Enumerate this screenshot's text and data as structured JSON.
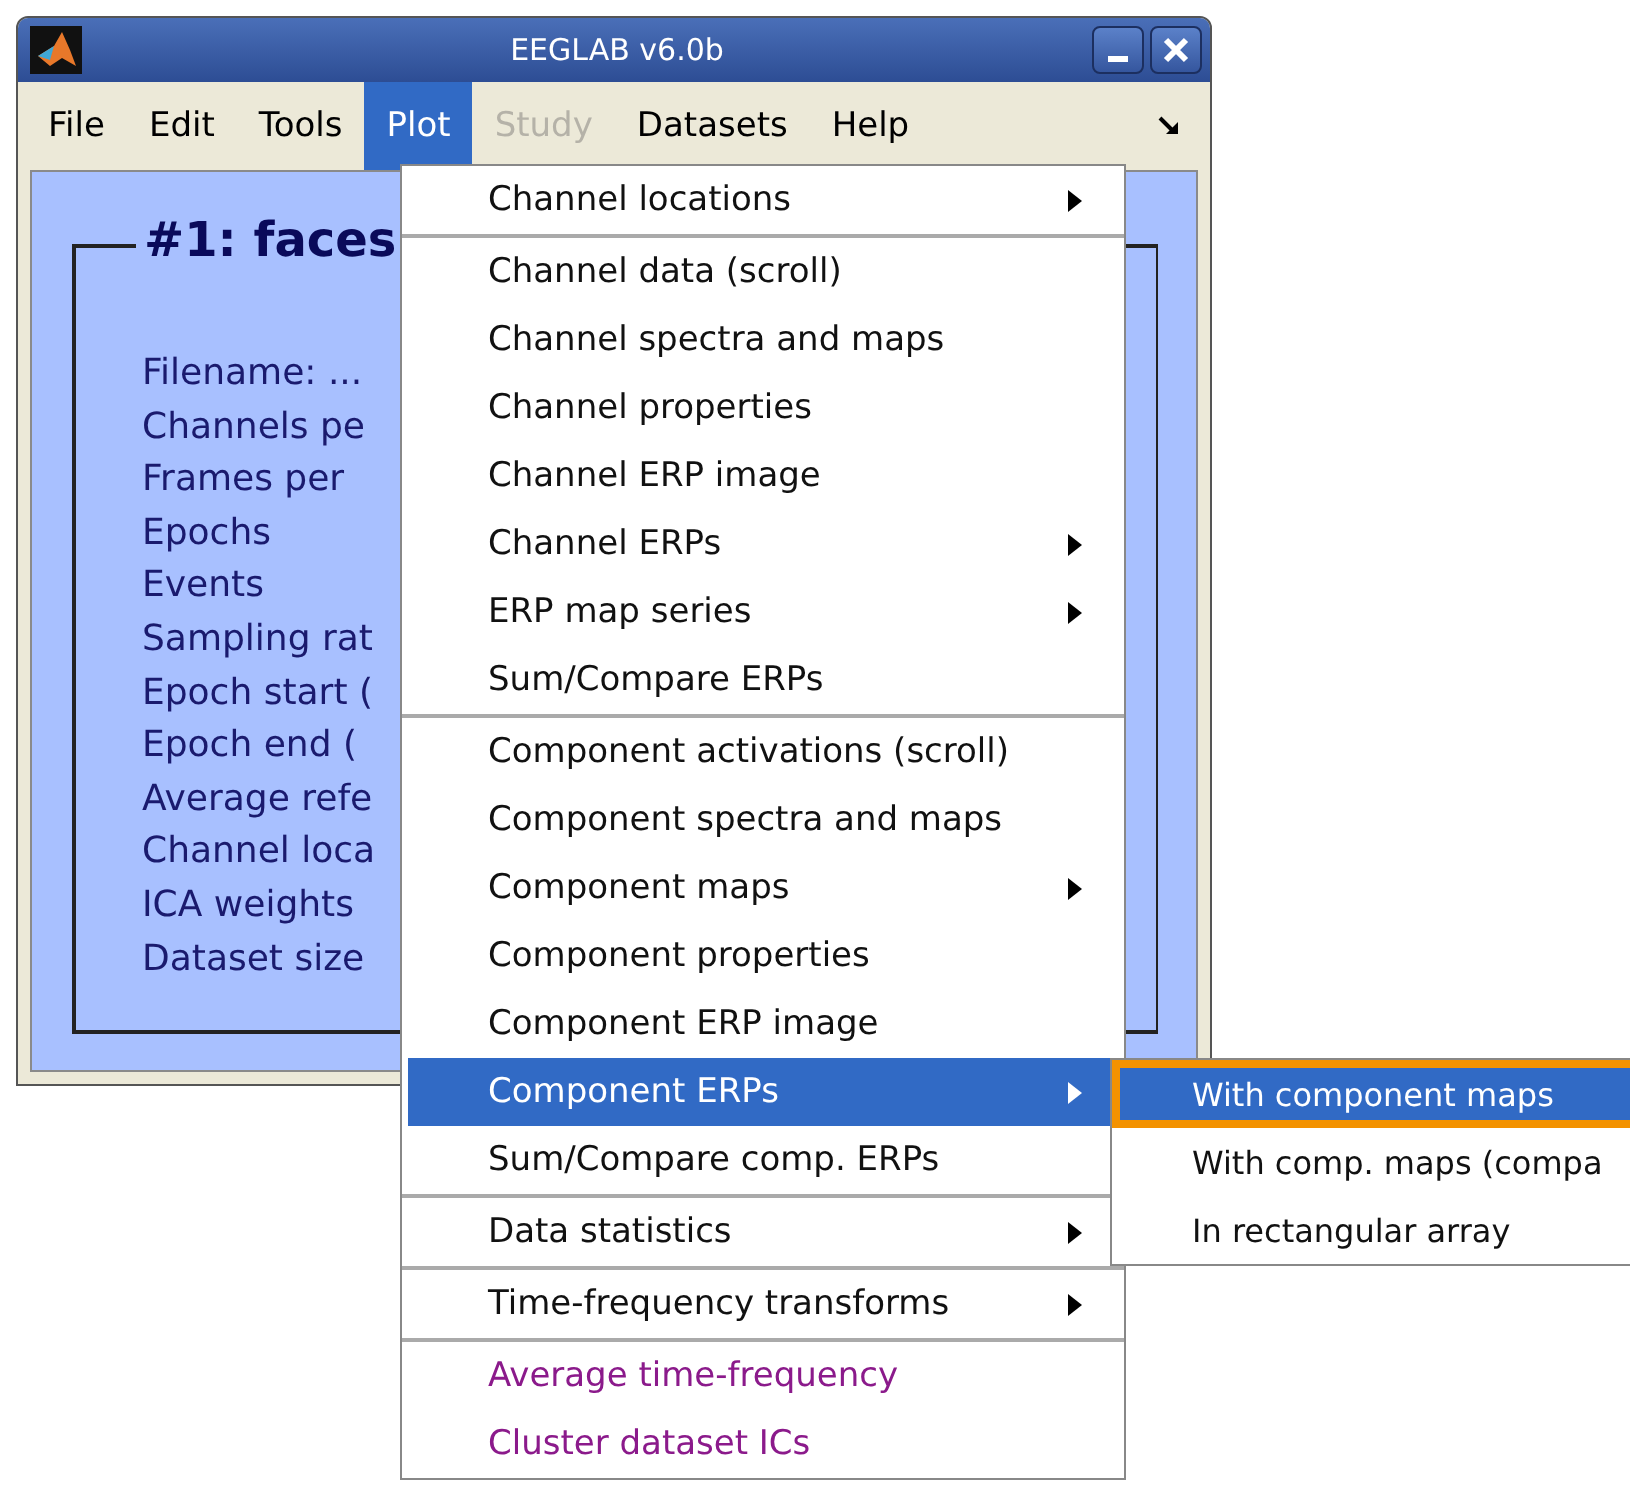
{
  "window": {
    "title": "EEGLAB v6.0b"
  },
  "menubar": [
    {
      "label": "File",
      "selected": false,
      "disabled": false
    },
    {
      "label": "Edit",
      "selected": false,
      "disabled": false
    },
    {
      "label": "Tools",
      "selected": false,
      "disabled": false
    },
    {
      "label": "Plot",
      "selected": true,
      "disabled": false
    },
    {
      "label": "Study",
      "selected": false,
      "disabled": true
    },
    {
      "label": "Datasets",
      "selected": false,
      "disabled": false
    },
    {
      "label": "Help",
      "selected": false,
      "disabled": false
    }
  ],
  "dataset_panel": {
    "title": "#1: faces",
    "fields": [
      "Filename: ...",
      "Channels pe",
      "Frames per",
      "Epochs",
      "Events",
      "Sampling rat",
      "Epoch start (",
      "Epoch end (",
      "Average refe",
      "Channel loca",
      "ICA weights",
      "Dataset size"
    ]
  },
  "plot_menu": [
    [
      {
        "label": "Channel locations",
        "kind": "command",
        "submenu": true,
        "selected": false
      }
    ],
    [
      {
        "label": "Channel data (scroll)",
        "kind": "command",
        "submenu": false,
        "selected": false
      },
      {
        "label": "Channel spectra and maps",
        "kind": "command",
        "submenu": false,
        "selected": false
      },
      {
        "label": "Channel properties",
        "kind": "command",
        "submenu": false,
        "selected": false
      },
      {
        "label": "Channel ERP image",
        "kind": "command",
        "submenu": false,
        "selected": false
      },
      {
        "label": "Channel ERPs",
        "kind": "command",
        "submenu": true,
        "selected": false
      },
      {
        "label": "ERP map series",
        "kind": "command",
        "submenu": true,
        "selected": false
      },
      {
        "label": "Sum/Compare ERPs",
        "kind": "command",
        "submenu": false,
        "selected": false
      }
    ],
    [
      {
        "label": "Component activations (scroll)",
        "kind": "command",
        "submenu": false,
        "selected": false
      },
      {
        "label": "Component spectra and maps",
        "kind": "command",
        "submenu": false,
        "selected": false
      },
      {
        "label": "Component maps",
        "kind": "command",
        "submenu": true,
        "selected": false
      },
      {
        "label": "Component properties",
        "kind": "command",
        "submenu": false,
        "selected": false
      },
      {
        "label": "Component ERP image",
        "kind": "command",
        "submenu": false,
        "selected": false
      },
      {
        "label": "Component ERPs",
        "kind": "command",
        "submenu": true,
        "selected": true
      },
      {
        "label": "Sum/Compare comp. ERPs",
        "kind": "command",
        "submenu": false,
        "selected": false
      }
    ],
    [
      {
        "label": "Data statistics",
        "kind": "command",
        "submenu": true,
        "selected": false
      }
    ],
    [
      {
        "label": "Time-frequency transforms",
        "kind": "command",
        "submenu": true,
        "selected": false
      }
    ],
    [
      {
        "label": "Average time-frequency",
        "kind": "plugin",
        "submenu": false,
        "selected": false
      },
      {
        "label": "Cluster dataset ICs",
        "kind": "plugin",
        "submenu": false,
        "selected": false
      }
    ]
  ],
  "component_erps_submenu": [
    {
      "label": "With component maps",
      "selected": true
    },
    {
      "label": "With comp. maps (compa",
      "selected": false
    },
    {
      "label": "In rectangular array",
      "selected": false
    }
  ]
}
